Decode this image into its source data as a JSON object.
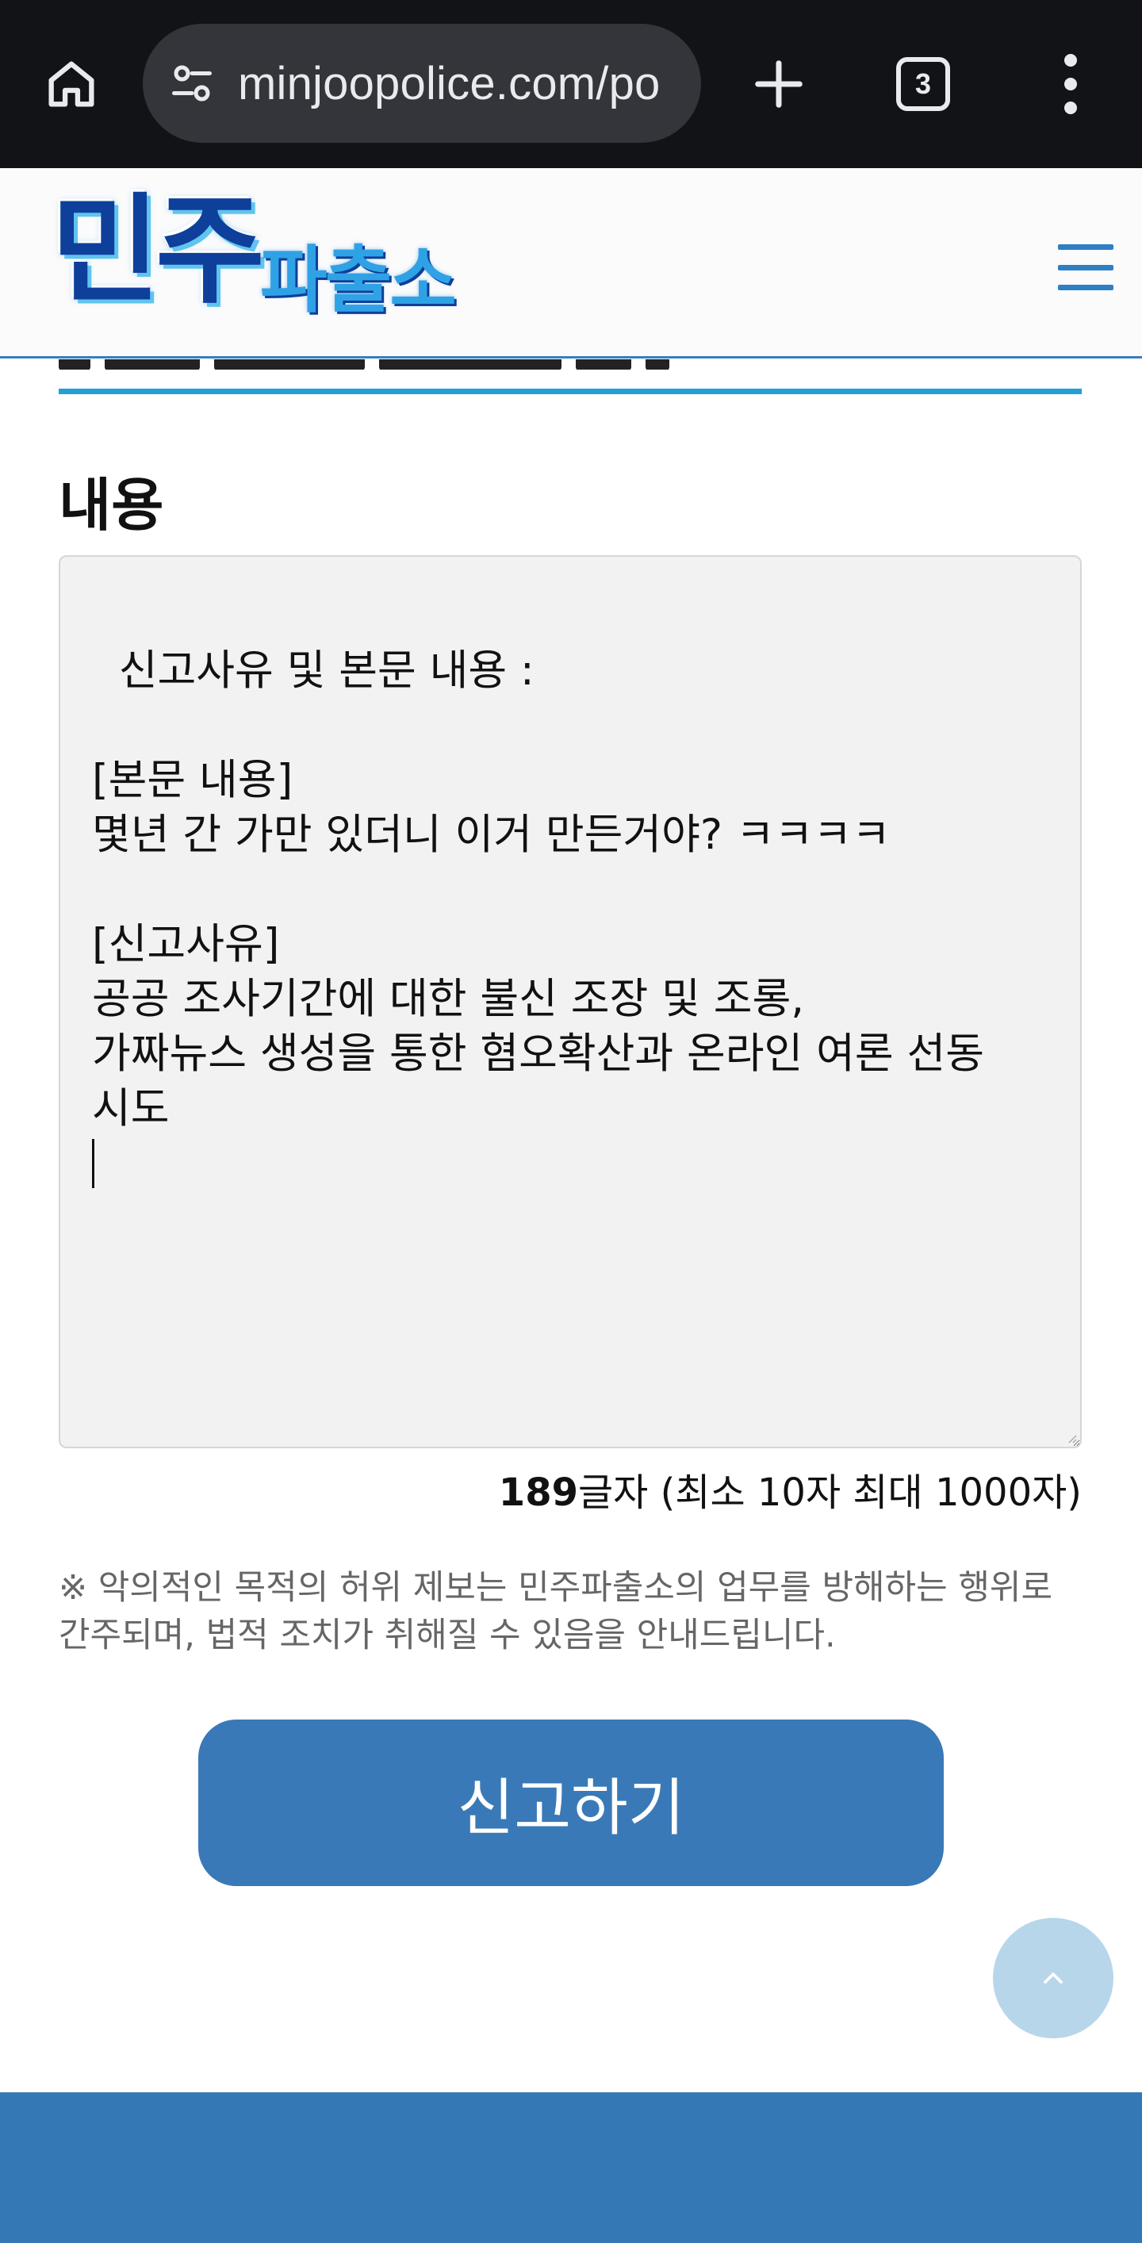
{
  "browser": {
    "url": "minjoopolice.com/po",
    "tab_count": "3"
  },
  "header": {
    "logo_main": "민주",
    "logo_sub": "파출소"
  },
  "form": {
    "section_label": "내용",
    "content": "신고사유 및 본문 내용 :\n\n[본문 내용]\n몇년 간 가만 있더니 이거 만든거야? ㅋㅋㅋㅋ\n\n[신고사유]\n공공 조사기간에 대한 불신 조장 및 조롱,\n가짜뉴스 생성을 통한 혐오확산과 온라인 여론 선동\n시도",
    "char_count_number": "189",
    "char_count_suffix": "글자 (최소 10자 최대 1000자)",
    "notice": "※ 악의적인 목적의 허위 제보는 민주파출소의 업무를 방해하는 행위로 간주되며, 법적 조치가 취해질 수 있음을 안내드립니다.",
    "submit_label": "신고하기"
  },
  "icons": {
    "home": "home-icon",
    "site_info": "tune-icon",
    "new_tab": "plus-icon",
    "more": "more-vertical-icon",
    "nav_menu": "hamburger-menu-icon",
    "scroll_top": "chevron-up-icon"
  },
  "colors": {
    "browser_bar": "#121317",
    "accent_blue": "#3a79b8",
    "rule_cyan": "#21a0d6",
    "footer": "#3478b6"
  }
}
